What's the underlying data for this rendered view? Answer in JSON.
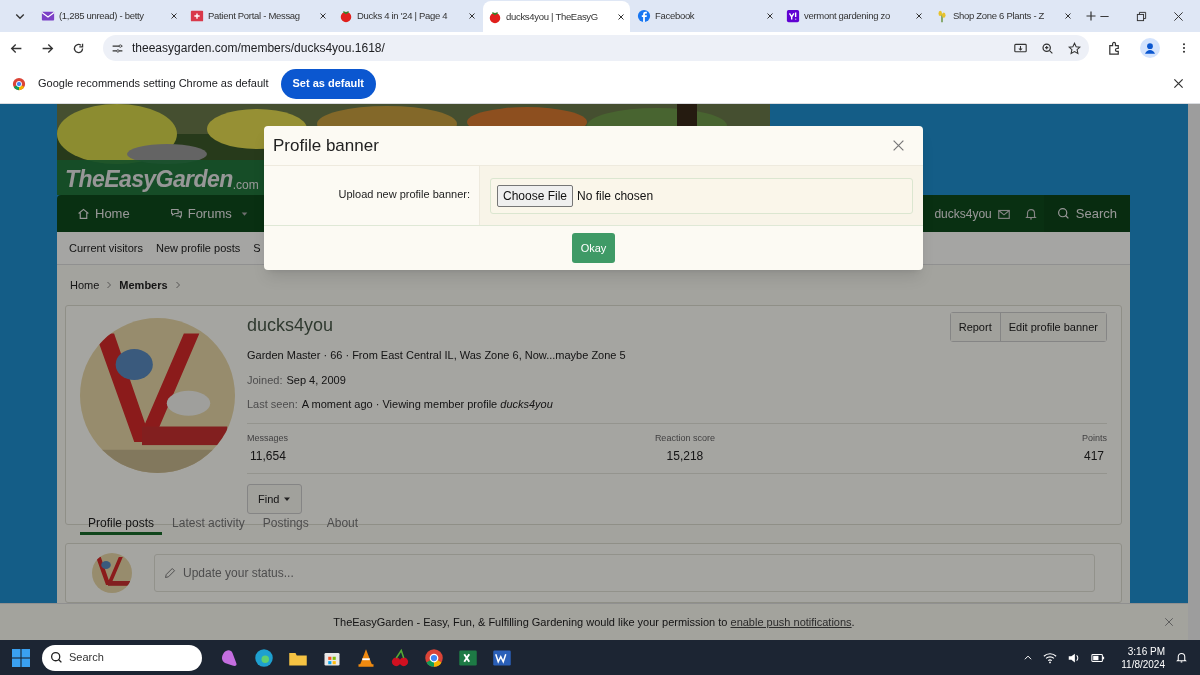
{
  "browser": {
    "tabs": [
      {
        "title": "(1,285 unread) - betty",
        "selected": false,
        "kind": "mail"
      },
      {
        "title": "Patient Portal - Messag",
        "selected": false,
        "kind": "portal"
      },
      {
        "title": "Ducks 4 in '24 | Page 4",
        "selected": false,
        "kind": "tomato"
      },
      {
        "title": "ducks4you | TheEasyG",
        "selected": true,
        "kind": "tomato"
      },
      {
        "title": "Facebook",
        "selected": false,
        "kind": "facebook"
      },
      {
        "title": "vermont gardening zo",
        "selected": false,
        "kind": "yahoo"
      },
      {
        "title": "Shop Zone 6 Plants - Z",
        "selected": false,
        "kind": "plant"
      }
    ],
    "address": "theeasygarden.com/members/ducks4you.1618/",
    "infobar": {
      "text": "Google recommends setting Chrome as default",
      "button": "Set as default"
    }
  },
  "site": {
    "logo": "TheEasyGarden",
    "logo_suffix": ".com",
    "nav": [
      {
        "label": "Home",
        "kind": "home",
        "caret": false
      },
      {
        "label": "Forums",
        "kind": "forums",
        "caret": true
      }
    ],
    "user": "ducks4you",
    "search": "Search",
    "subnav": [
      "Current visitors",
      "New profile posts",
      "S"
    ],
    "breadcrumb": [
      "Home",
      "Members"
    ]
  },
  "profile": {
    "name": "ducks4you",
    "blurb": "Garden Master · 66 · From East Central IL, Was Zone 6, Now...maybe Zone 5",
    "joined_label": "Joined:",
    "joined": "Sep 4, 2009",
    "last_seen_label": "Last seen:",
    "last_seen": "A moment ago · Viewing member profile *ducks4you*",
    "buttons": [
      "Report",
      "Edit profile banner"
    ],
    "stats": [
      {
        "label": "Messages",
        "value": "11,654"
      },
      {
        "label": "Reaction score",
        "value": "15,218"
      },
      {
        "label": "Points",
        "value": "417"
      }
    ],
    "find": "Find",
    "tabs": [
      {
        "label": "Profile posts",
        "selected": true
      },
      {
        "label": "Latest activity",
        "selected": false
      },
      {
        "label": "Postings",
        "selected": false
      },
      {
        "label": "About",
        "selected": false
      }
    ],
    "status_placeholder": "Update your status..."
  },
  "modal": {
    "title": "Profile banner",
    "field_label": "Upload new profile banner:",
    "choose": "Choose File",
    "no_file": "No file chosen",
    "ok": "Okay"
  },
  "notification": {
    "text": "TheEasyGarden - Easy, Fun, & Fulfilling Gardening would like your permission to ",
    "link": "enable push notifications",
    "end": "."
  },
  "taskbar": {
    "search": "Search",
    "time": "3:16 PM",
    "date": "11/8/2024"
  }
}
